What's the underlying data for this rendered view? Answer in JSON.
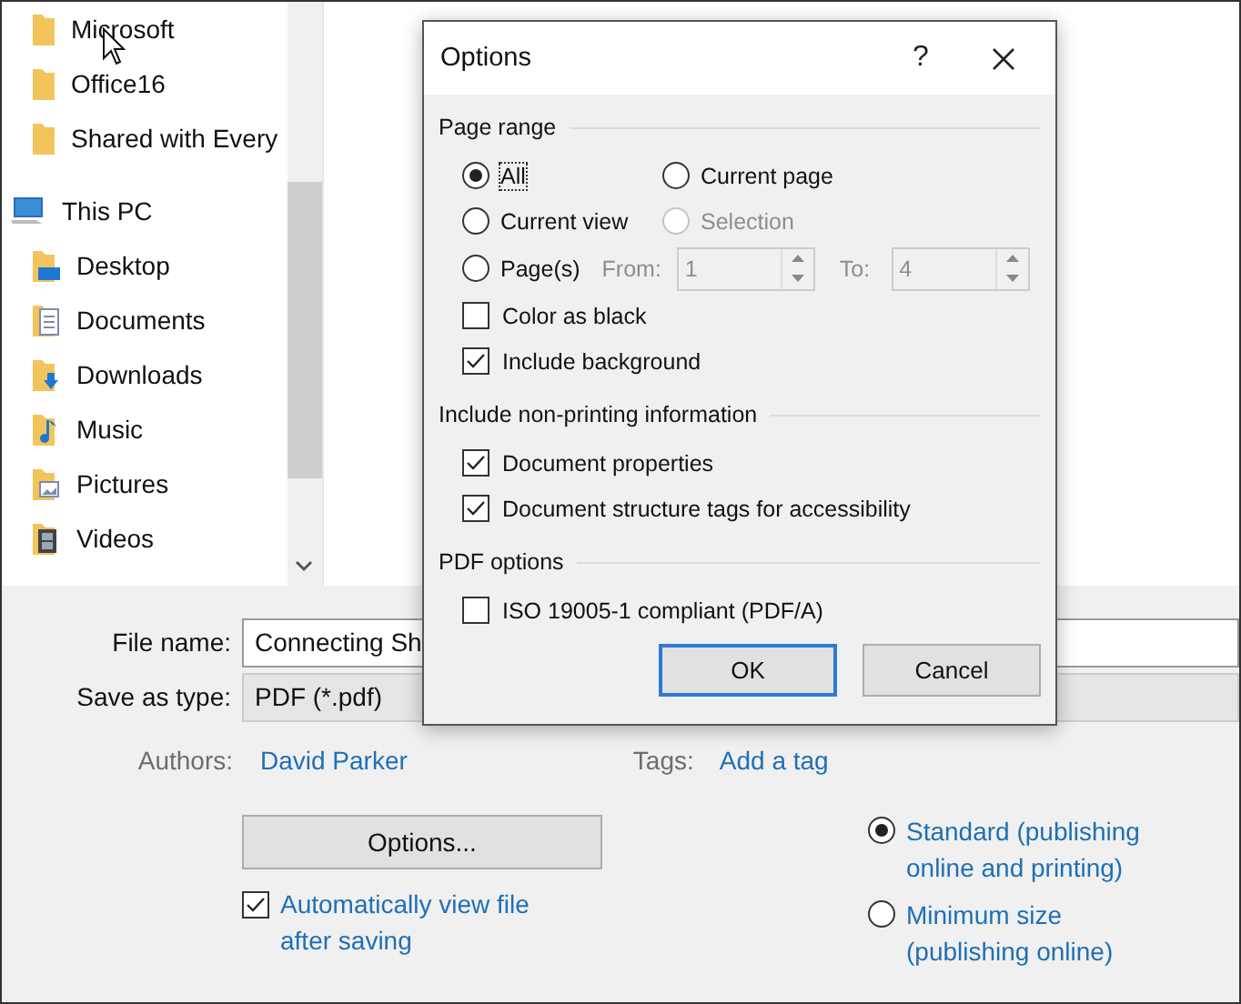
{
  "sidebar": {
    "tree": [
      {
        "children": [
          {
            "label": "Microsoft",
            "kind": "folder"
          },
          {
            "label": "Office16",
            "kind": "folder"
          },
          {
            "label": "Shared with Every",
            "kind": "folder"
          }
        ]
      },
      {
        "label": "This PC",
        "kind": "pc",
        "children": [
          {
            "label": "Desktop",
            "kind": "desktop"
          },
          {
            "label": "Documents",
            "kind": "documents"
          },
          {
            "label": "Downloads",
            "kind": "downloads"
          },
          {
            "label": "Music",
            "kind": "music"
          },
          {
            "label": "Pictures",
            "kind": "pictures"
          },
          {
            "label": "Videos",
            "kind": "videos"
          }
        ]
      }
    ]
  },
  "file_name": {
    "label": "File name:",
    "value": "Connecting Sh"
  },
  "save_as_type": {
    "label": "Save as type:",
    "value": "PDF (*.pdf)"
  },
  "authors": {
    "label": "Authors:",
    "value": "David Parker"
  },
  "tags": {
    "label": "Tags:",
    "value": "Add a tag"
  },
  "options_button": "Options...",
  "auto_view": {
    "label": "Automatically view file after saving",
    "checked": true
  },
  "optimize": [
    {
      "label": "Standard (publishing online and printing)",
      "selected": true
    },
    {
      "label": "Minimum size (publishing online)",
      "selected": false
    }
  ],
  "options_dialog": {
    "title": "Options",
    "help": "?",
    "page_range": {
      "title": "Page range",
      "radios": [
        {
          "label": "All",
          "selected": true,
          "disabled": false
        },
        {
          "label": "Current page",
          "selected": false,
          "disabled": false
        },
        {
          "label": "Current view",
          "selected": false,
          "disabled": false
        },
        {
          "label": "Selection",
          "selected": false,
          "disabled": true
        },
        {
          "label": "Page(s)",
          "selected": false,
          "disabled": false
        }
      ],
      "from": {
        "label": "From:",
        "value": "1",
        "disabled": true
      },
      "to": {
        "label": "To:",
        "value": "4",
        "disabled": true
      },
      "checkboxes": [
        {
          "label": "Color as black",
          "checked": false
        },
        {
          "label": "Include background",
          "checked": true
        }
      ]
    },
    "non_printing": {
      "title": "Include non-printing information",
      "checkboxes": [
        {
          "label": "Document properties",
          "checked": true
        },
        {
          "label": "Document structure tags for accessibility",
          "checked": true
        }
      ]
    },
    "pdf_options": {
      "title": "PDF options",
      "checkboxes": [
        {
          "label": "ISO 19005-1 compliant (PDF/A)",
          "checked": false
        }
      ]
    },
    "buttons": [
      {
        "label": "OK",
        "default": true
      },
      {
        "label": "Cancel",
        "default": false
      }
    ]
  }
}
